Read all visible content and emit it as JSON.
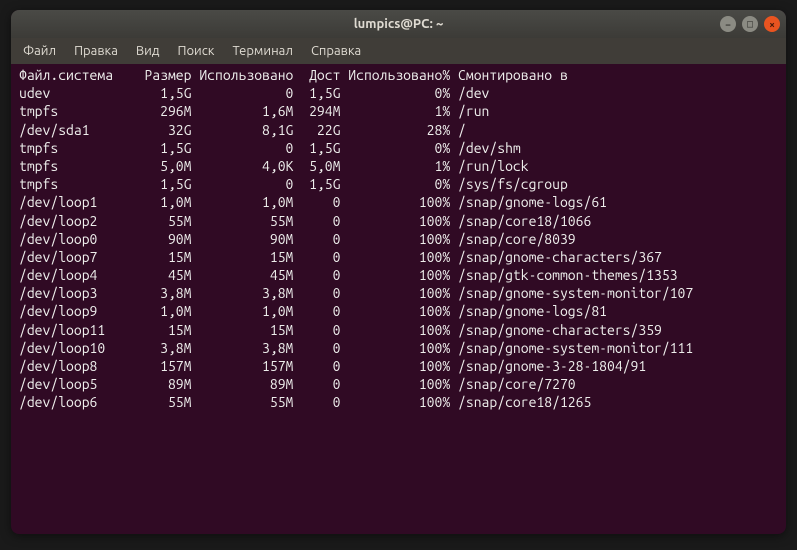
{
  "window": {
    "title": "lumpics@PC: ~"
  },
  "menubar": {
    "items": [
      "Файл",
      "Правка",
      "Вид",
      "Поиск",
      "Терминал",
      "Справка"
    ]
  },
  "headers": {
    "filesystem": "Файл.система",
    "size": "Размер",
    "used": "Использовано",
    "avail": "Дост",
    "use_pct": "Использовано%",
    "mounted": "Смонтировано в"
  },
  "rows": [
    {
      "fs": "udev",
      "size": "1,5G",
      "used": "0",
      "avail": "1,5G",
      "pct": "0%",
      "mnt": "/dev"
    },
    {
      "fs": "tmpfs",
      "size": "296M",
      "used": "1,6M",
      "avail": "294M",
      "pct": "1%",
      "mnt": "/run"
    },
    {
      "fs": "/dev/sda1",
      "size": "32G",
      "used": "8,1G",
      "avail": "22G",
      "pct": "28%",
      "mnt": "/"
    },
    {
      "fs": "tmpfs",
      "size": "1,5G",
      "used": "0",
      "avail": "1,5G",
      "pct": "0%",
      "mnt": "/dev/shm"
    },
    {
      "fs": "tmpfs",
      "size": "5,0M",
      "used": "4,0K",
      "avail": "5,0M",
      "pct": "1%",
      "mnt": "/run/lock"
    },
    {
      "fs": "tmpfs",
      "size": "1,5G",
      "used": "0",
      "avail": "1,5G",
      "pct": "0%",
      "mnt": "/sys/fs/cgroup"
    },
    {
      "fs": "/dev/loop1",
      "size": "1,0M",
      "used": "1,0M",
      "avail": "0",
      "pct": "100%",
      "mnt": "/snap/gnome-logs/61"
    },
    {
      "fs": "/dev/loop2",
      "size": "55M",
      "used": "55M",
      "avail": "0",
      "pct": "100%",
      "mnt": "/snap/core18/1066"
    },
    {
      "fs": "/dev/loop0",
      "size": "90M",
      "used": "90M",
      "avail": "0",
      "pct": "100%",
      "mnt": "/snap/core/8039"
    },
    {
      "fs": "/dev/loop7",
      "size": "15M",
      "used": "15M",
      "avail": "0",
      "pct": "100%",
      "mnt": "/snap/gnome-characters/367"
    },
    {
      "fs": "/dev/loop4",
      "size": "45M",
      "used": "45M",
      "avail": "0",
      "pct": "100%",
      "mnt": "/snap/gtk-common-themes/1353"
    },
    {
      "fs": "/dev/loop3",
      "size": "3,8M",
      "used": "3,8M",
      "avail": "0",
      "pct": "100%",
      "mnt": "/snap/gnome-system-monitor/107"
    },
    {
      "fs": "/dev/loop9",
      "size": "1,0M",
      "used": "1,0M",
      "avail": "0",
      "pct": "100%",
      "mnt": "/snap/gnome-logs/81"
    },
    {
      "fs": "/dev/loop11",
      "size": "15M",
      "used": "15M",
      "avail": "0",
      "pct": "100%",
      "mnt": "/snap/gnome-characters/359"
    },
    {
      "fs": "/dev/loop10",
      "size": "3,8M",
      "used": "3,8M",
      "avail": "0",
      "pct": "100%",
      "mnt": "/snap/gnome-system-monitor/111"
    },
    {
      "fs": "/dev/loop8",
      "size": "157M",
      "used": "157M",
      "avail": "0",
      "pct": "100%",
      "mnt": "/snap/gnome-3-28-1804/91"
    },
    {
      "fs": "/dev/loop5",
      "size": "89M",
      "used": "89M",
      "avail": "0",
      "pct": "100%",
      "mnt": "/snap/core/7270"
    },
    {
      "fs": "/dev/loop6",
      "size": "55M",
      "used": "55M",
      "avail": "0",
      "pct": "100%",
      "mnt": "/snap/core18/1265"
    }
  ],
  "cols": {
    "fs": 14,
    "size": 8,
    "used": 13,
    "avail": 6,
    "pct": 14
  },
  "wrap_width": 89
}
